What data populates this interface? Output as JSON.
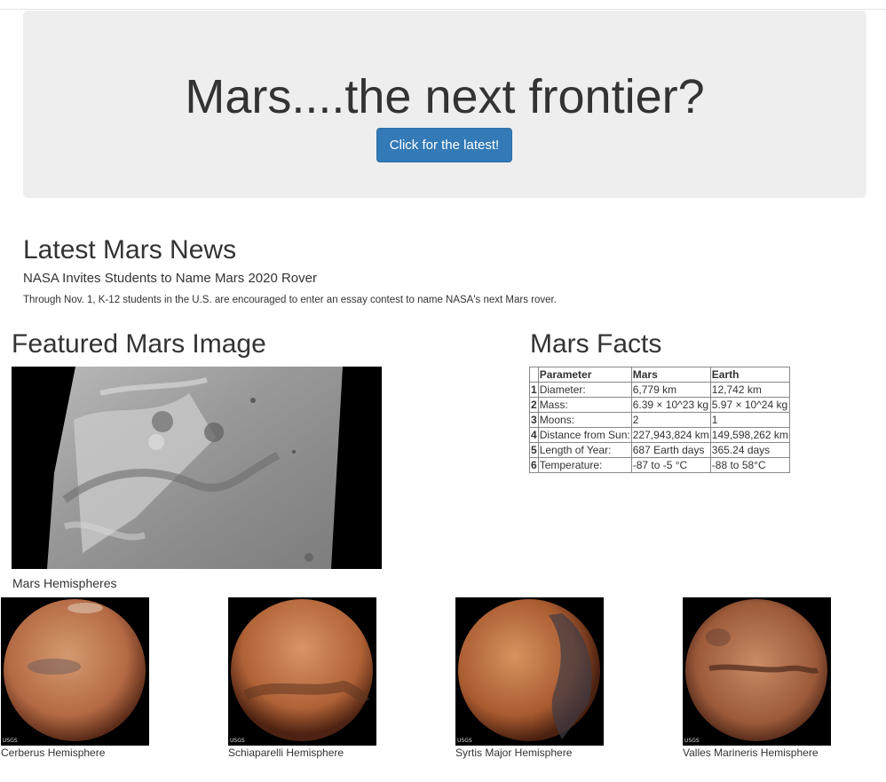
{
  "hero": {
    "title": "Mars....the next frontier?",
    "button_label": "Click for the latest!",
    "button_color": "#337ab7"
  },
  "news": {
    "heading": "Latest Mars News",
    "title": "NASA Invites Students to Name Mars 2020 Rover",
    "paragraph": "Through Nov. 1, K-12 students in the U.S. are encouraged to enter an essay contest to name NASA's next Mars rover."
  },
  "featured": {
    "heading": "Featured Mars Image"
  },
  "facts": {
    "heading": "Mars Facts",
    "columns": [
      "Parameter",
      "Mars",
      "Earth"
    ],
    "rows": [
      {
        "index": "1",
        "parameter": "Diameter:",
        "mars": "6,779 km",
        "earth": "12,742 km"
      },
      {
        "index": "2",
        "parameter": "Mass:",
        "mars": "6.39 × 10^23 kg",
        "earth": "5.97 × 10^24 kg"
      },
      {
        "index": "3",
        "parameter": "Moons:",
        "mars": "2",
        "earth": "1"
      },
      {
        "index": "4",
        "parameter": "Distance from Sun:",
        "mars": "227,943,824 km",
        "earth": "149,598,262 km"
      },
      {
        "index": "5",
        "parameter": "Length of Year:",
        "mars": "687 Earth days",
        "earth": "365.24 days"
      },
      {
        "index": "6",
        "parameter": "Temperature:",
        "mars": "-87 to -5 °C",
        "earth": "-88 to 58°C"
      }
    ]
  },
  "hemispheres": {
    "heading": "Mars Hemispheres",
    "items": [
      {
        "title": "Cerberus Hemisphere"
      },
      {
        "title": "Schiaparelli Hemisphere"
      },
      {
        "title": "Syrtis Major Hemisphere"
      },
      {
        "title": "Valles Marineris Hemisphere"
      }
    ],
    "usgs_label": "USGS"
  }
}
